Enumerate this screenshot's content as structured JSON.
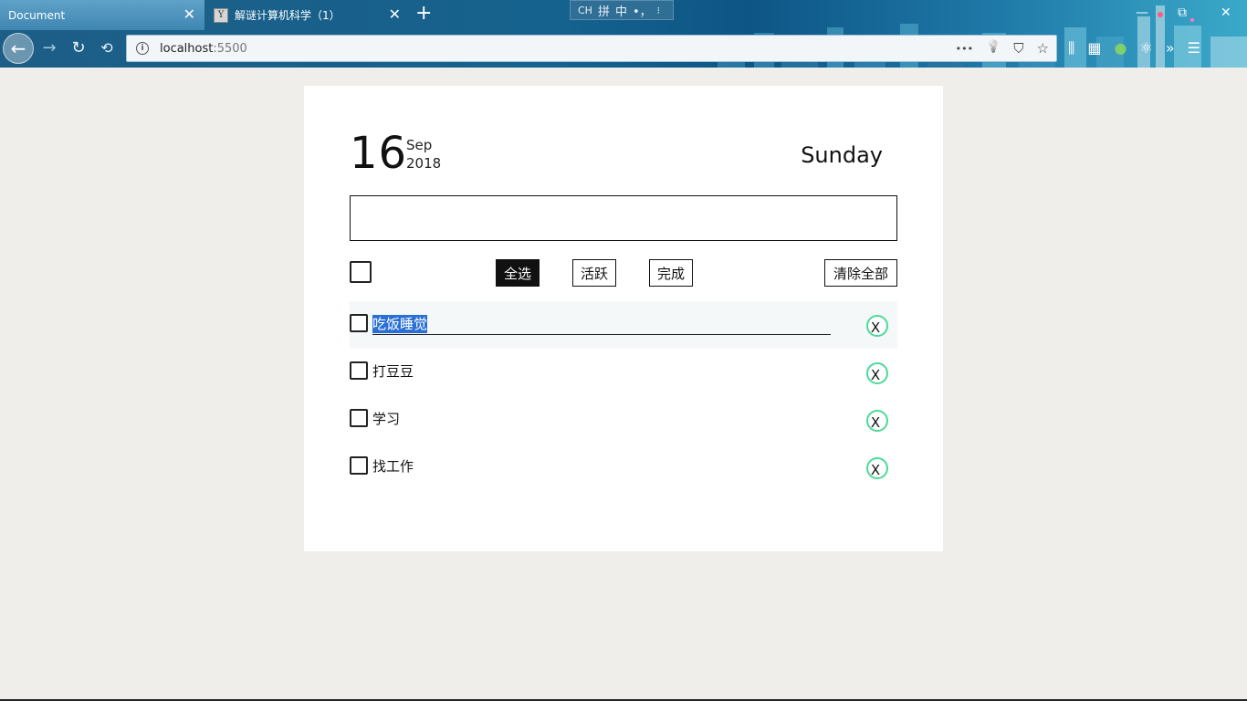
{
  "browser": {
    "tabs": [
      {
        "title": "Document",
        "active": true
      },
      {
        "title": "解谜计算机科学（1）",
        "active": false,
        "favicon": "Y"
      }
    ],
    "new_tab": "+",
    "ime": {
      "mode": "CH",
      "layout": "拼",
      "char": "中",
      "punct": "•，",
      "more": "⁝"
    },
    "window_controls": {
      "minimize": "—",
      "restore": "⧉",
      "close": "✕"
    },
    "url_host": "localhost",
    "url_port": ":5500",
    "icons": {
      "back": "back-arrow-icon",
      "forward": "forward-arrow-icon",
      "reload": "reload-icon",
      "history": "history-icon",
      "info": "info-icon",
      "more": "more-icon",
      "idea": "lightbulb-icon",
      "pocket": "pocket-icon",
      "bookmark": "star-icon"
    },
    "glyphs": {
      "back": "←",
      "forward": "→",
      "reload": "↻",
      "history": "⟲",
      "info": "i",
      "more": "•••",
      "idea": "💡",
      "pocket": "⛉",
      "bookmark": "☆",
      "library": "⫼",
      "sidebar": "▦",
      "ext1": "●",
      "ext2": "⚛",
      "overflow": "»",
      "menu": "☰"
    }
  },
  "todo": {
    "day": "16",
    "month": "Sep",
    "year": "2018",
    "weekday": "Sunday",
    "input_value": "",
    "filters": {
      "all": "全选",
      "active": "活跃",
      "done": "完成",
      "clear": "清除全部"
    },
    "selected_filter": "all",
    "items": [
      {
        "text": "吃饭睡觉",
        "editing": true,
        "completed": false
      },
      {
        "text": "打豆豆",
        "editing": false,
        "completed": false
      },
      {
        "text": "学习",
        "editing": false,
        "completed": false
      },
      {
        "text": "找工作",
        "editing": false,
        "completed": false
      }
    ],
    "delete_label": "X",
    "colors": {
      "delete_ring": "#4dd99a",
      "selection": "#2a6fd6",
      "accent": "#111111"
    }
  }
}
